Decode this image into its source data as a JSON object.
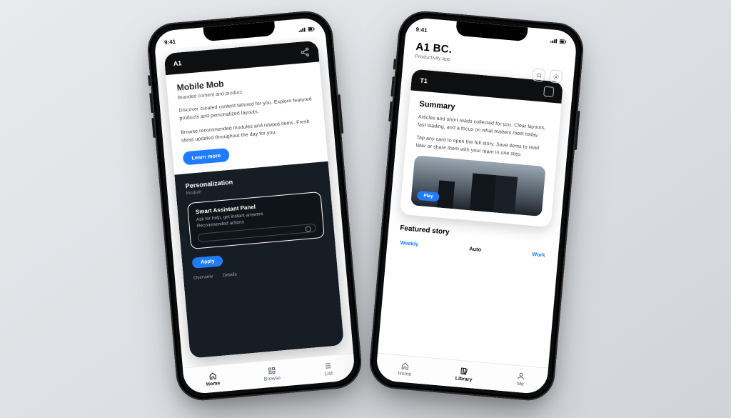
{
  "status": {
    "time": "9:41"
  },
  "left": {
    "cardHead": "A1",
    "title": "Mobile Mob",
    "subtitle": "Branded content and product",
    "para1": "Discover curated content tailored for you. Explore featured products and personalized layouts.",
    "para2": "Browse recommended modules and related items. Fresh ideas updated throughout the day for you.",
    "cta": "Learn more",
    "darkTitle": "Personalization",
    "darkSub": "Module",
    "hlTitle": "Smart Assistant Panel",
    "hlLine": "Ask for help, get instant answers",
    "hlMeta": "Recommended actions",
    "footA": "Overview",
    "footB": "Details",
    "darkBtn": "Apply",
    "tabs": [
      "Home",
      "Browse",
      "List"
    ]
  },
  "right": {
    "brand": "A1 BC.",
    "tagline": "Productivity app",
    "cardHead": "T1",
    "section": "Summary",
    "para1": "Articles and short reads collected for you. Clear layouts, fast loading, and a focus on what matters most today.",
    "para2": "Tap any card to open the full story. Save items to read later or share them with your team in one step.",
    "mediaChip": "Play",
    "section2": "Featured story",
    "tabs": [
      "Weekly",
      "Auto",
      "Work"
    ],
    "bottom": [
      "Home",
      "Library",
      "Me"
    ]
  }
}
